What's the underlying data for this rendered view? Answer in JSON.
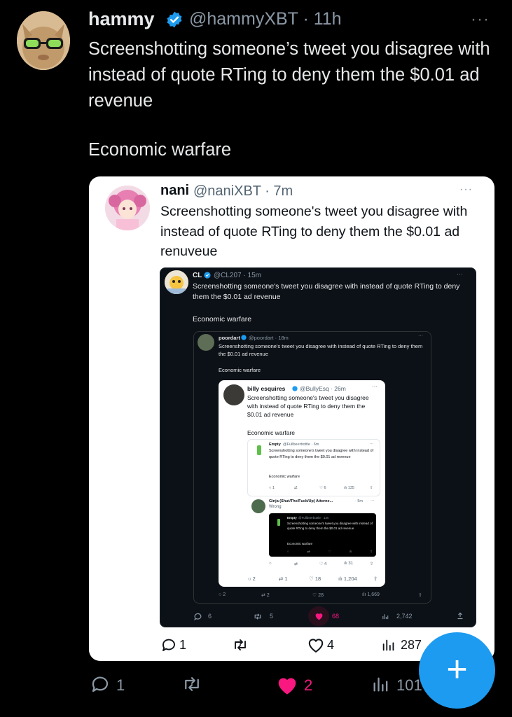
{
  "tweet": {
    "display_name": "hammy",
    "handle_time": "@hammyXBT · 11h",
    "body": "Screenshotting someone’s tweet you disagree with instead of quote RTing to deny them the $0.01 ad revenue",
    "footer": "Economic warfare",
    "more": "···",
    "actions": {
      "reply": "1",
      "like": "2",
      "views": "101"
    }
  },
  "quote": {
    "display_name": "nani",
    "handle_time": "@naniXBT · 7m",
    "body": "Screenshotting someone's tweet you disagree with instead of quote RTing to deny them the $0.01 ad renuveue",
    "more": "···",
    "actions": {
      "reply": "1",
      "like": "4",
      "views": "287"
    }
  },
  "shot_cl": {
    "display_name": "CL",
    "handle_time": "@CL207 · 15m",
    "body": "Screenshotting someone's tweet you disagree with instead of quote RTing to deny them the $0.01 ad revenue",
    "footer": "Economic warfare",
    "more": "···",
    "actions": {
      "reply": "6",
      "retweet": "5",
      "like": "68",
      "views": "2,742"
    }
  },
  "shot_poordart": {
    "display_name": "poordart",
    "handle_time": "@poordart · 18m",
    "body": "Screenshotting someone's tweet you disagree with instead of quote RTing to deny them the $0.01 ad revenue",
    "footer": "Economic warfare",
    "more": "···",
    "actions": {
      "reply": "2",
      "retweet": "2",
      "like": "28",
      "views": "1,669"
    }
  },
  "shot_billy": {
    "display_name": "billy esquires",
    "handle_time": "@BullyEsq · 26m",
    "body": "Screenshotting someone's tweet you disagree with instead of quote RTing to deny them the $0.01 ad revenue",
    "footer": "Economic warfare",
    "more": "···",
    "actions": {
      "reply": "2",
      "retweet": "1",
      "like": "18",
      "views": "1,204"
    }
  },
  "shot_empty": {
    "display_name": "Empty",
    "handle_time": "@Fullbeerbottle · 6m",
    "body": "Screenshotting someone's tweet you disagree with instead of quote RTing to deny them the $0.01 ad revenue",
    "footer": "Economic warfare",
    "more": "···",
    "actions": {
      "reply": "1",
      "like": "6",
      "views": "135"
    }
  },
  "shot_ginja": {
    "display_name": "Ginja (Shut/The/Fuck/Up) Attorne...",
    "handle_time": "· 5m",
    "body": "Wrong",
    "more": "···",
    "actions": {
      "like": "4",
      "views": "31"
    }
  },
  "shot_empty2": {
    "display_name": "Empty",
    "handle_time": "@Fullbeerbottle · 14s",
    "body": "Screenshotting someone's tweet you disagree with instead of quote RTing to deny them the $0.01 ad revenue",
    "footer": "Economic warfare"
  },
  "fab": {
    "label": "+"
  },
  "colors": {
    "like_pink": "#f91880",
    "accent_blue": "#1d9bf0",
    "verified_blue": "#1d9bf0"
  }
}
